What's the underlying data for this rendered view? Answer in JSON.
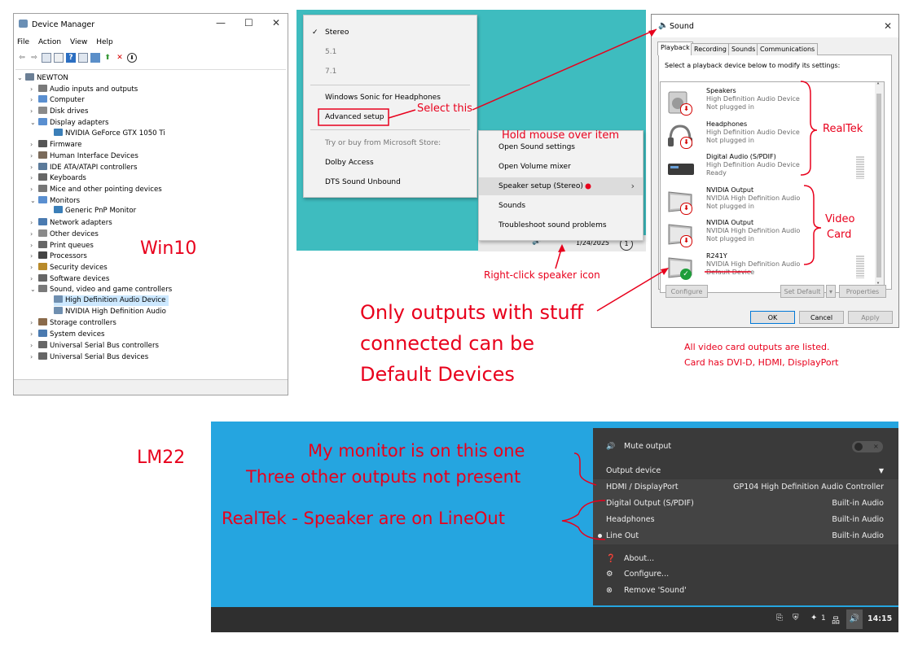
{
  "device_manager": {
    "title": "Device Manager",
    "menu": [
      "File",
      "Action",
      "View",
      "Help"
    ],
    "tree": [
      {
        "label": "NEWTON",
        "level": 0,
        "expanded": true
      },
      {
        "label": "Audio inputs and outputs",
        "level": 1
      },
      {
        "label": "Computer",
        "level": 1
      },
      {
        "label": "Disk drives",
        "level": 1
      },
      {
        "label": "Display adapters",
        "level": 1,
        "expanded": true
      },
      {
        "label": "NVIDIA GeForce GTX 1050 Ti",
        "level": 2
      },
      {
        "label": "Firmware",
        "level": 1
      },
      {
        "label": "Human Interface Devices",
        "level": 1
      },
      {
        "label": "IDE ATA/ATAPI controllers",
        "level": 1
      },
      {
        "label": "Keyboards",
        "level": 1
      },
      {
        "label": "Mice and other pointing devices",
        "level": 1
      },
      {
        "label": "Monitors",
        "level": 1,
        "expanded": true
      },
      {
        "label": "Generic PnP Monitor",
        "level": 2
      },
      {
        "label": "Network adapters",
        "level": 1
      },
      {
        "label": "Other devices",
        "level": 1
      },
      {
        "label": "Print queues",
        "level": 1
      },
      {
        "label": "Processors",
        "level": 1
      },
      {
        "label": "Security devices",
        "level": 1
      },
      {
        "label": "Software devices",
        "level": 1
      },
      {
        "label": "Sound, video and game controllers",
        "level": 1,
        "expanded": true
      },
      {
        "label": "High Definition Audio Device",
        "level": 2,
        "selected": true
      },
      {
        "label": "NVIDIA High Definition Audio",
        "level": 2
      },
      {
        "label": "Storage controllers",
        "level": 1
      },
      {
        "label": "System devices",
        "level": 1
      },
      {
        "label": "Universal Serial Bus controllers",
        "level": 1
      },
      {
        "label": "Universal Serial Bus devices",
        "level": 1
      }
    ]
  },
  "speaker_menu": {
    "items": [
      "Stereo",
      "5.1",
      "7.1",
      "Windows Sonic for Headphones",
      "Advanced setup",
      "Try or buy from Microsoft Store:",
      "Dolby Access",
      "DTS Sound Unbound"
    ],
    "checked": "✓"
  },
  "context_menu": {
    "items": [
      "Open Sound settings",
      "Open Volume mixer",
      "Speaker setup (Stereo)",
      "Sounds",
      "Troubleshoot sound problems"
    ],
    "date": "1/24/2025",
    "notify": "1"
  },
  "sound_dialog": {
    "title": "Sound",
    "tabs": [
      "Playback",
      "Recording",
      "Sounds",
      "Communications"
    ],
    "instruction": "Select a playback device below to modify its settings:",
    "devices": [
      {
        "name": "Speakers",
        "driver": "High Definition Audio Device",
        "status": "Not plugged in",
        "icon": "speaker"
      },
      {
        "name": "Headphones",
        "driver": "High Definition Audio Device",
        "status": "Not plugged in",
        "icon": "headphones"
      },
      {
        "name": "Digital Audio (S/PDIF)",
        "driver": "High Definition Audio Device",
        "status": "Ready",
        "icon": "spdif"
      },
      {
        "name": "NVIDIA Output",
        "driver": "NVIDIA High Definition Audio",
        "status": "Not plugged in",
        "icon": "monitor"
      },
      {
        "name": "NVIDIA Output",
        "driver": "NVIDIA High Definition Audio",
        "status": "Not plugged in",
        "icon": "monitor"
      },
      {
        "name": "R241Y",
        "driver": "NVIDIA High Definition Audio",
        "status": "Default Device",
        "icon": "monitor-default"
      }
    ],
    "buttons": {
      "configure": "Configure",
      "set_default": "Set Default",
      "properties": "Properties",
      "ok": "OK",
      "cancel": "Cancel",
      "apply": "Apply"
    }
  },
  "lm_menu": {
    "mute": "Mute output",
    "output_device": "Output device",
    "outputs": [
      {
        "name": "HDMI / DisplayPort",
        "desc": "GP104 High Definition Audio Controller",
        "active": false
      },
      {
        "name": "Digital Output (S/PDIF)",
        "desc": "Built-in Audio",
        "active": false
      },
      {
        "name": "Headphones",
        "desc": "Built-in Audio",
        "active": false
      },
      {
        "name": "Line Out",
        "desc": "Built-in Audio",
        "active": true
      }
    ],
    "actions": [
      "About...",
      "Configure...",
      "Remove 'Sound'"
    ],
    "tray_count": "1",
    "clock": "14:15"
  },
  "annotations": {
    "select_this": "Select this",
    "hold_mouse": "Hold mouse over item",
    "right_click": "Right-click speaker icon",
    "realtek": "RealTek",
    "video_card_1": "Video",
    "video_card_2": "Card",
    "win10": "Win10",
    "only_outputs_1": "Only outputs with stuff",
    "only_outputs_2": "connected can be",
    "only_outputs_3": "Default Devices",
    "all_listed_1": "All video card outputs are listed.",
    "all_listed_2": "Card has DVI-D, HDMI, DisplayPort",
    "lm22": "LM22",
    "monitor_1": "My monitor is on this one",
    "monitor_2": "Three other outputs not present",
    "realtek_lineout": "RealTek - Speaker are on LineOut"
  },
  "colors": {
    "accent_red": "#e8001c",
    "lm_blue": "#25a5e0",
    "win_teal": "#3ebcbf"
  }
}
